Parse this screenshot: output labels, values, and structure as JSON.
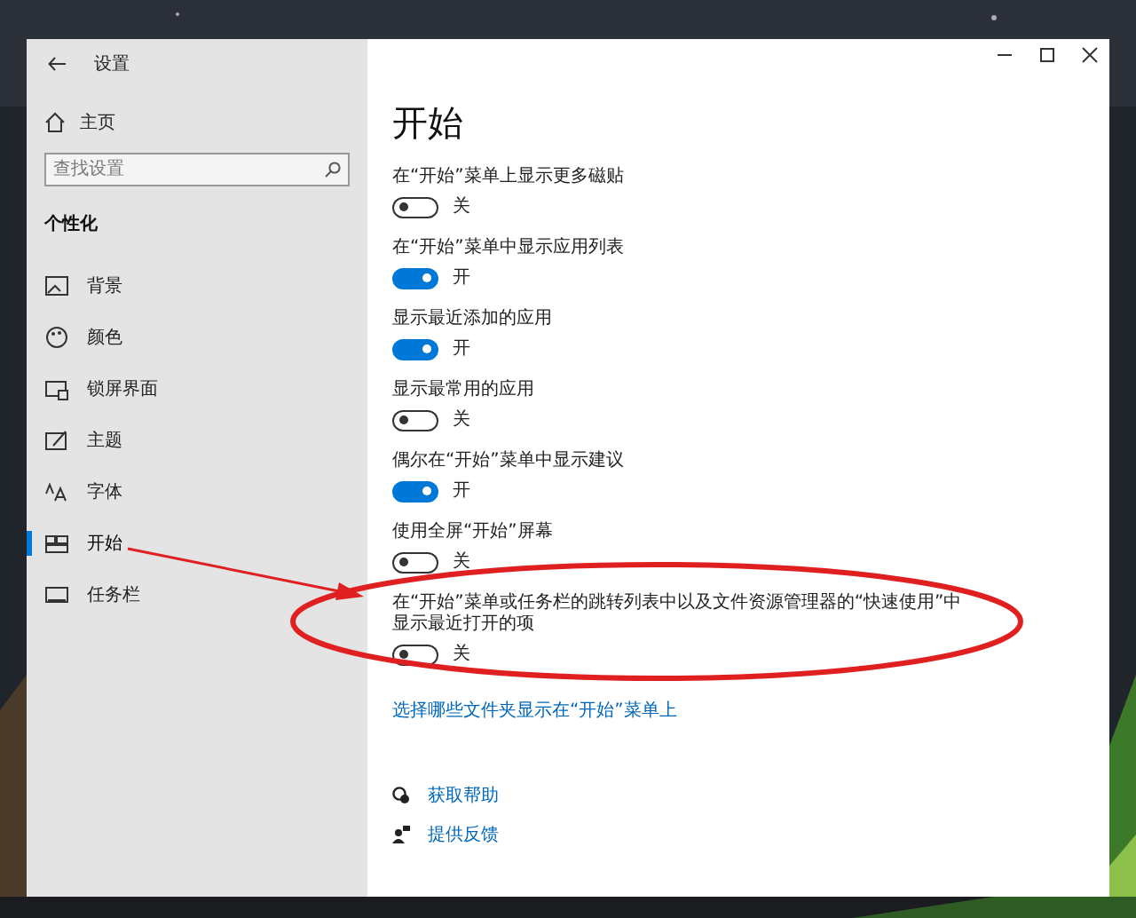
{
  "window": {
    "title": "设置"
  },
  "sidebar": {
    "home": "主页",
    "search": {
      "placeholder": "查找设置"
    },
    "section": "个性化",
    "items": [
      {
        "label": "背景",
        "selected": false
      },
      {
        "label": "颜色",
        "selected": false
      },
      {
        "label": "锁屏界面",
        "selected": false
      },
      {
        "label": "主题",
        "selected": false
      },
      {
        "label": "字体",
        "selected": false
      },
      {
        "label": "开始",
        "selected": true
      },
      {
        "label": "任务栏",
        "selected": false
      }
    ]
  },
  "content": {
    "title": "开始",
    "settings": [
      {
        "label": "在“开始”菜单上显示更多磁贴",
        "on": false,
        "state": "关"
      },
      {
        "label": "在“开始”菜单中显示应用列表",
        "on": true,
        "state": "开"
      },
      {
        "label": "显示最近添加的应用",
        "on": true,
        "state": "开"
      },
      {
        "label": "显示最常用的应用",
        "on": false,
        "state": "关"
      },
      {
        "label": "偶尔在“开始”菜单中显示建议",
        "on": true,
        "state": "开"
      },
      {
        "label": "使用全屏“开始”屏幕",
        "on": false,
        "state": "关"
      },
      {
        "label": "在“开始”菜单或任务栏的跳转列表中以及文件资源管理器的“快速使用”中显示最近打开的项",
        "on": false,
        "state": "关"
      }
    ],
    "link": "选择哪些文件夹显示在“开始”菜单上",
    "help": [
      {
        "label": "获取帮助"
      },
      {
        "label": "提供反馈"
      }
    ]
  }
}
